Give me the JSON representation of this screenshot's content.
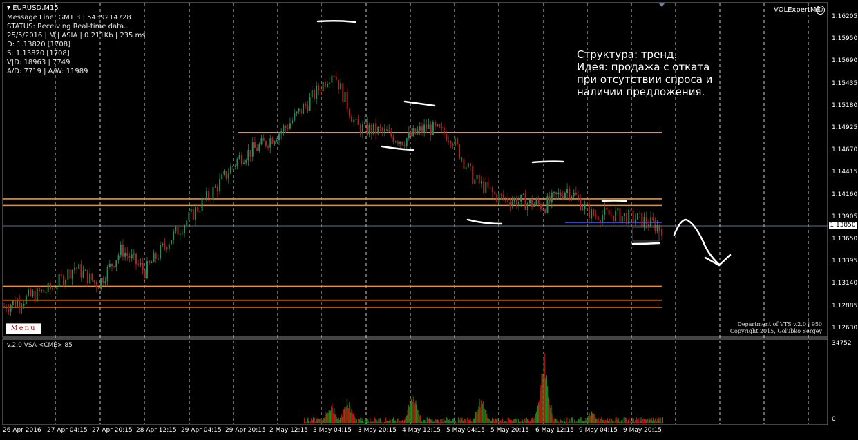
{
  "window": {
    "symbol_title": "EURUSD,M15",
    "ea_name": "VOLExpertME"
  },
  "info_panel": {
    "lines": [
      "Message Line: GMT 3 | 5439214728",
      "STATUS: Receiving Real-time data..",
      "25/5/2016 | M | ASIA | 0.211Kb | 235 ms",
      "D: 1.13820  [1708]",
      "S: 1.13820  [1708]",
      "V|D: 18963 | 7749",
      "A/D: 7719 | A/W: 11989"
    ]
  },
  "annotation": {
    "lines": [
      "Структура: тренд.",
      "Идея: продажа  с отката",
      "при отсутствии спроса и",
      "наличии предложения."
    ]
  },
  "menu_button": {
    "label": "Menu"
  },
  "credits": {
    "line1": "Department of VTS  v.2.0 | 950",
    "line2": "Copyright 2015, Golubko Sergey"
  },
  "price_axis": {
    "labels": [
      "1.16205",
      "1.15950",
      "1.15690",
      "1.15435",
      "1.15180",
      "1.14925",
      "1.14670",
      "1.14415",
      "1.14160",
      "1.13905",
      "1.13650",
      "1.13395",
      "1.13140",
      "1.12885",
      "1.12630"
    ]
  },
  "current_price": "1.13850",
  "volume_axis": {
    "max_label": "34752",
    "min_label": "0"
  },
  "subwindow": {
    "title": "v.2.0 VSA <CME> 85"
  },
  "time_axis": {
    "labels": [
      "26 Apr 2016",
      "27 Apr 04:15",
      "27 Apr 20:15",
      "28 Apr 12:15",
      "29 Apr 04:15",
      "29 Apr 20:15",
      "2 May 12:15",
      "3 May 04:15",
      "3 May 20:15",
      "4 May 12:15",
      "5 May 04:15",
      "5 May 20:15",
      "6 May 12:15",
      "9 May 04:15",
      "9 May 20:15"
    ]
  },
  "colors": {
    "background": "#000000",
    "level_lines": "#ff8c1a",
    "bull_candle": "#2e8b57",
    "bear_candle": "#b22222",
    "grid": "#ffffff",
    "vol_green": "#1a8a1a",
    "vol_red": "#cc1111"
  },
  "chart_data": {
    "type": "candlestick",
    "symbol": "EURUSD",
    "timeframe": "M15",
    "ylim": [
      1.1263,
      1.1625
    ],
    "horizontal_levels": [
      1.1494,
      1.1418,
      1.14105,
      1.1318,
      1.1302,
      1.1294
    ],
    "close_path": {
      "x": [
        "26 Apr 2016",
        "26 Apr 12:00",
        "27 Apr 04:15",
        "27 Apr 12:00",
        "27 Apr 20:15",
        "28 Apr 04:00",
        "28 Apr 12:15",
        "28 Apr 20:00",
        "29 Apr 04:15",
        "29 Apr 12:00",
        "29 Apr 20:15",
        "2 May 04:00",
        "2 May 12:15",
        "2 May 20:00",
        "3 May 04:15",
        "3 May 12:00",
        "3 May 20:15",
        "4 May 04:00",
        "4 May 12:15",
        "4 May 20:00",
        "5 May 04:15",
        "5 May 12:00",
        "5 May 20:15",
        "6 May 04:00",
        "6 May 12:15",
        "6 May 20:00",
        "9 May 04:15",
        "9 May 12:00",
        "9 May 20:15"
      ],
      "y": [
        1.1295,
        1.1305,
        1.1315,
        1.134,
        1.132,
        1.136,
        1.1335,
        1.137,
        1.14,
        1.143,
        1.1465,
        1.148,
        1.15,
        1.153,
        1.1565,
        1.15,
        1.1495,
        1.1485,
        1.15,
        1.149,
        1.144,
        1.142,
        1.1415,
        1.141,
        1.143,
        1.14,
        1.14,
        1.1395,
        1.1385
      ]
    }
  }
}
